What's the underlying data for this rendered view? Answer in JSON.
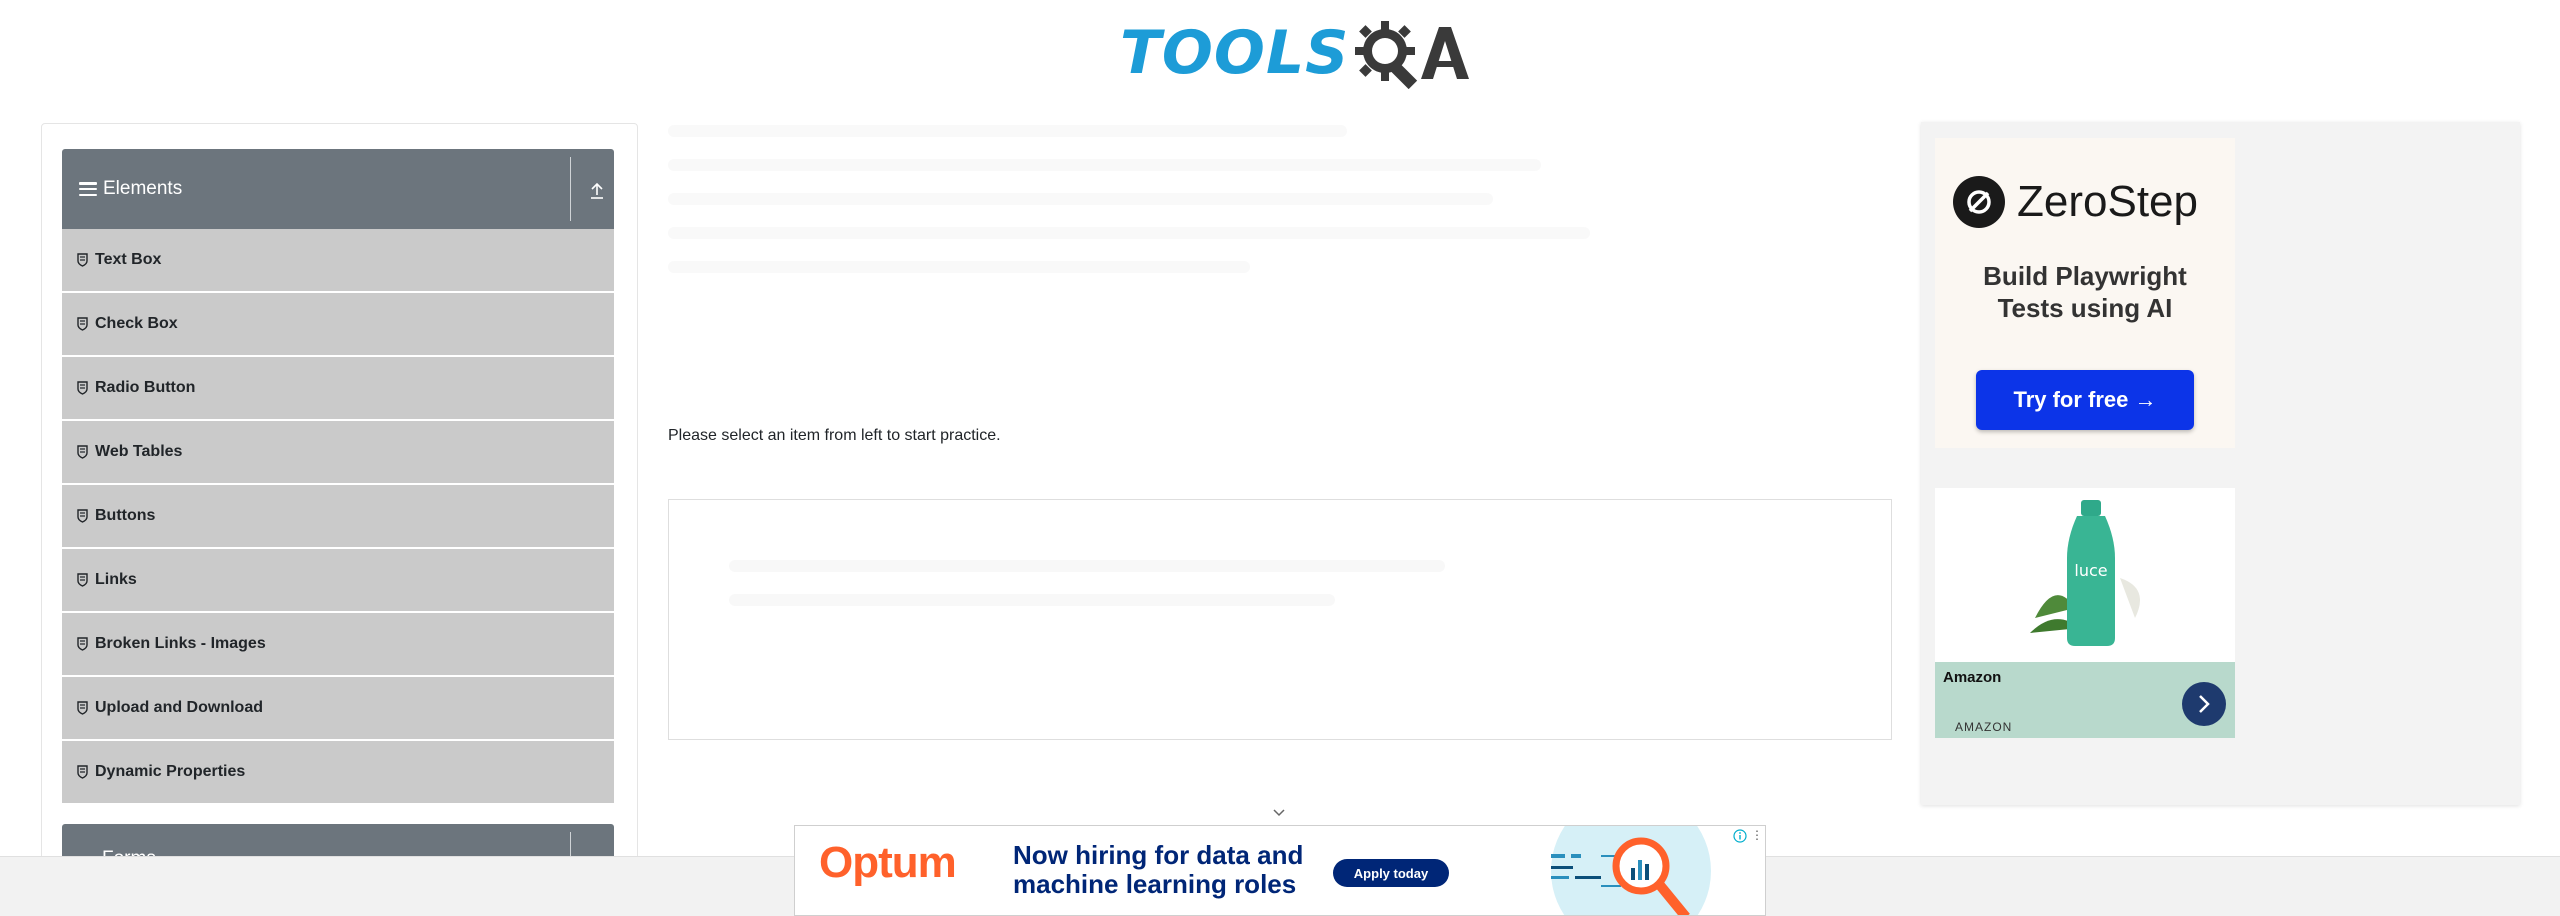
{
  "header": {
    "logo_text": "TOOLS",
    "logo_alt": "TOOLSQA"
  },
  "sidebar": {
    "group_title": "Elements",
    "items": [
      {
        "label": "Text Box"
      },
      {
        "label": "Check Box"
      },
      {
        "label": "Radio Button"
      },
      {
        "label": "Web Tables"
      },
      {
        "label": "Buttons"
      },
      {
        "label": "Links"
      },
      {
        "label": "Broken Links - Images"
      },
      {
        "label": "Upload and Download"
      },
      {
        "label": "Dynamic Properties"
      }
    ],
    "next_group_title": "Forms"
  },
  "main": {
    "instruction": "Please select an item from left to start practice."
  },
  "right_ad": {
    "brand": "ZeroStep",
    "headline_line1": "Build Playwright",
    "headline_line2": "Tests using AI",
    "cta": "Try for free →",
    "product_brand": "luce",
    "seller_title": "Amazon",
    "seller_sub": "AMAZON"
  },
  "bottom_ad": {
    "brand": "Optum",
    "headline_line1": "Now hiring for data and",
    "headline_line2": "machine learning roles",
    "cta": "Apply today"
  },
  "colors": {
    "sidebar_header": "#6c757d",
    "menu_item_bg": "#cacaca",
    "logo_blue": "#1d9cd7",
    "zerostep_button": "#0c34e8",
    "optum_orange": "#ff612b",
    "optum_navy": "#002677"
  }
}
